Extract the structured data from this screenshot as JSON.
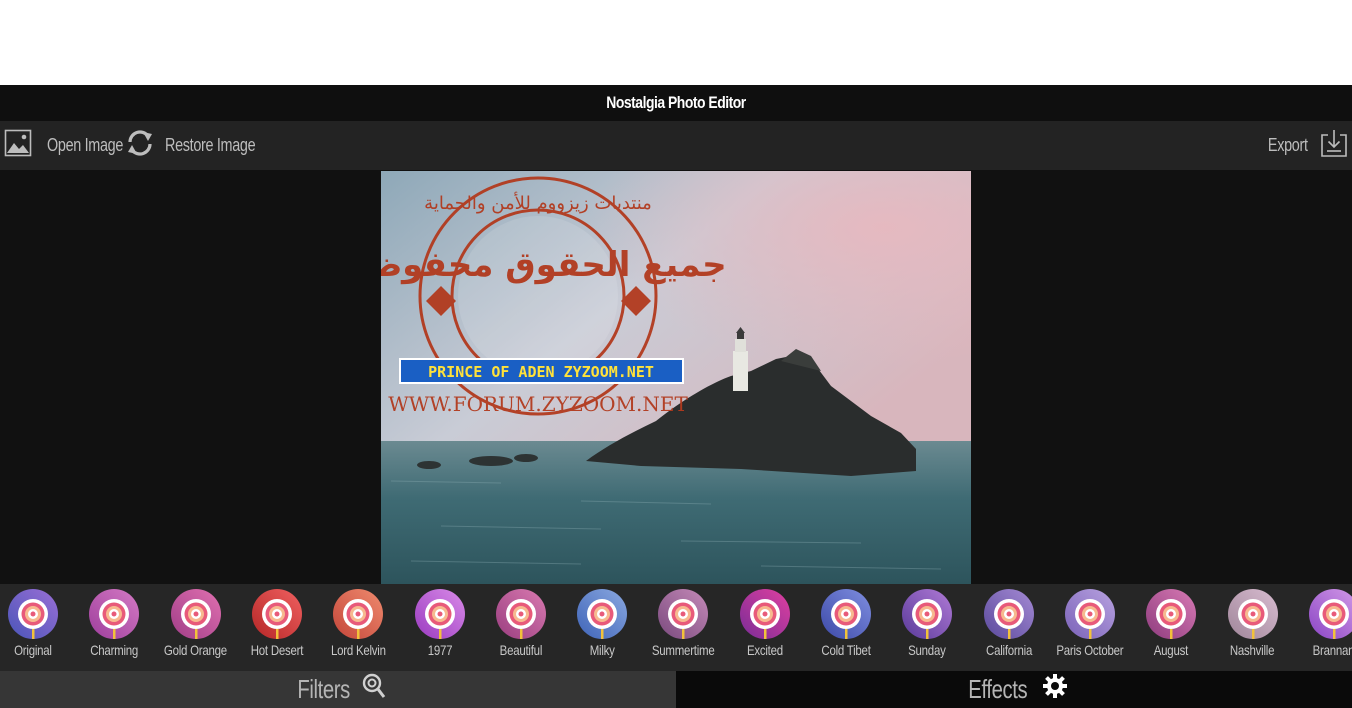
{
  "app": {
    "title": "Nostalgia Photo Editor"
  },
  "toolbar": {
    "open_label": "Open Image",
    "restore_label": "Restore Image",
    "export_label": "Export",
    "open_icon": "image-icon",
    "restore_icon": "refresh-icon",
    "export_icon": "download-icon"
  },
  "photo": {
    "watermark_lines": [
      "PRINCE OF ADEN ZYZOOM.NET",
      "WWW.FORUM.ZYZOOM.NET"
    ],
    "watermark_arabic_top": "منتديات زيزووم للأمن والحماية",
    "watermark_arabic_center": "جميع الحقوق محفوظة",
    "colors": {
      "sky": "#c7cad3",
      "sea": "#3d6a73",
      "rock": "#2a2c2c",
      "stamp": "#b23a1e"
    }
  },
  "filters": [
    {
      "label": "Original",
      "colors": [
        "#4a55b8",
        "#9a6fd6"
      ]
    },
    {
      "label": "Charming",
      "colors": [
        "#9e3e9c",
        "#d47ac4"
      ]
    },
    {
      "label": "Gold Orange",
      "colors": [
        "#a13e88",
        "#e070b0"
      ]
    },
    {
      "label": "Hot Desert",
      "colors": [
        "#b52727",
        "#f06060"
      ]
    },
    {
      "label": "Lord Kelvin",
      "colors": [
        "#c4463a",
        "#ef8a6e"
      ]
    },
    {
      "label": "1977",
      "colors": [
        "#9a3bc0",
        "#d98be8"
      ]
    },
    {
      "label": "Beautiful",
      "colors": [
        "#9a3e80",
        "#d97ab0"
      ]
    },
    {
      "label": "Milky",
      "colors": [
        "#3f64b8",
        "#8aa8e0"
      ]
    },
    {
      "label": "Summertime",
      "colors": [
        "#7a4a7e",
        "#c58ab8"
      ]
    },
    {
      "label": "Excited",
      "colors": [
        "#7a2c96",
        "#e040a0"
      ]
    },
    {
      "label": "Cold Tibet",
      "colors": [
        "#3d4aa8",
        "#7f8ee0"
      ]
    },
    {
      "label": "Sunday",
      "colors": [
        "#5a3b9a",
        "#b07ad6"
      ]
    },
    {
      "label": "California",
      "colors": [
        "#5a4a9c",
        "#a58ad4"
      ]
    },
    {
      "label": "Paris October",
      "colors": [
        "#7a62b8",
        "#b8a2e0"
      ]
    },
    {
      "label": "August",
      "colors": [
        "#8e3c7e",
        "#d87ab4"
      ]
    },
    {
      "label": "Nashville",
      "colors": [
        "#a0869a",
        "#d8bcd0"
      ]
    },
    {
      "label": "Brannan",
      "colors": [
        "#8a45c4",
        "#d49be8"
      ]
    }
  ],
  "tabs": {
    "filters_label": "Filters",
    "effects_label": "Effects",
    "filters_icon": "lollipop-icon",
    "effects_icon": "gear-icon"
  }
}
